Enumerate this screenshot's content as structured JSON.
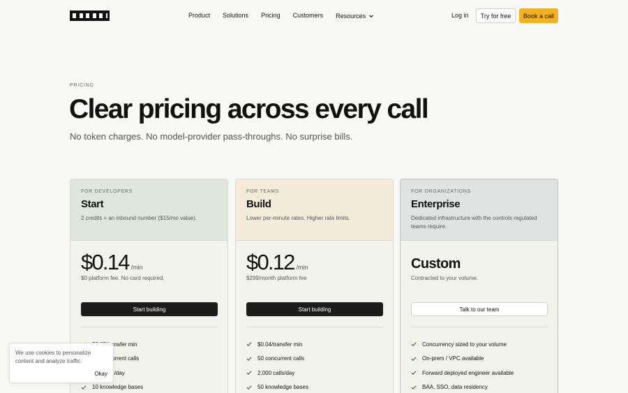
{
  "nav": {
    "links": [
      "Product",
      "Solutions",
      "Pricing",
      "Customers",
      "Resources"
    ],
    "login": "Log in",
    "try_free": "Try for free",
    "book_call": "Book a call"
  },
  "hero": {
    "eyebrow": "PRICING",
    "title": "Clear pricing across every call",
    "subtitle": "No token charges. No model-provider pass-throughs. No surprise bills."
  },
  "plans": [
    {
      "tier": "FOR DEVELOPERS",
      "name": "Start",
      "description": "2 credits + an inbound number ($15/mo value).",
      "price": "$0.14",
      "unit": "/min",
      "price_note": "$0 platform fee. No card required.",
      "cta": "Start building",
      "features": [
        "$0.05/transfer min",
        "10 concurrent calls",
        "100 calls/day",
        "10 knowledge bases"
      ]
    },
    {
      "tier": "FOR TEAMS",
      "name": "Build",
      "description": "Lower per-minute rates. Higher rate limits.",
      "price": "$0.12",
      "unit": "/min",
      "price_note": "$299/month platform fee",
      "cta": "Start building",
      "features": [
        "$0.04/transfer min",
        "50 concurrent calls",
        "2,000 calls/day",
        "50 knowledge bases"
      ]
    },
    {
      "tier": "FOR ORGANIZATIONS",
      "name": "Enterprise",
      "description": "Dedicated infrastructure with the controls regulated teams require.",
      "price": "Custom",
      "price_note": "Contracted to your volume.",
      "cta": "Talk to our team",
      "features": [
        "Concurrency sized to your volume",
        "On-prem / VPC available",
        "Forward deployed engineer available",
        "BAA, SSO, data residency"
      ]
    }
  ],
  "cookie": {
    "text": "We use cookies to personalize content and analyze traffic.",
    "okay": "Okay"
  },
  "colors": {
    "accent": "#f4b223",
    "developers_header": "#dfe7dc",
    "teams_header": "#f4ecd9",
    "organizations_header": "#e1e3e3",
    "check": "#2e6b3a"
  }
}
